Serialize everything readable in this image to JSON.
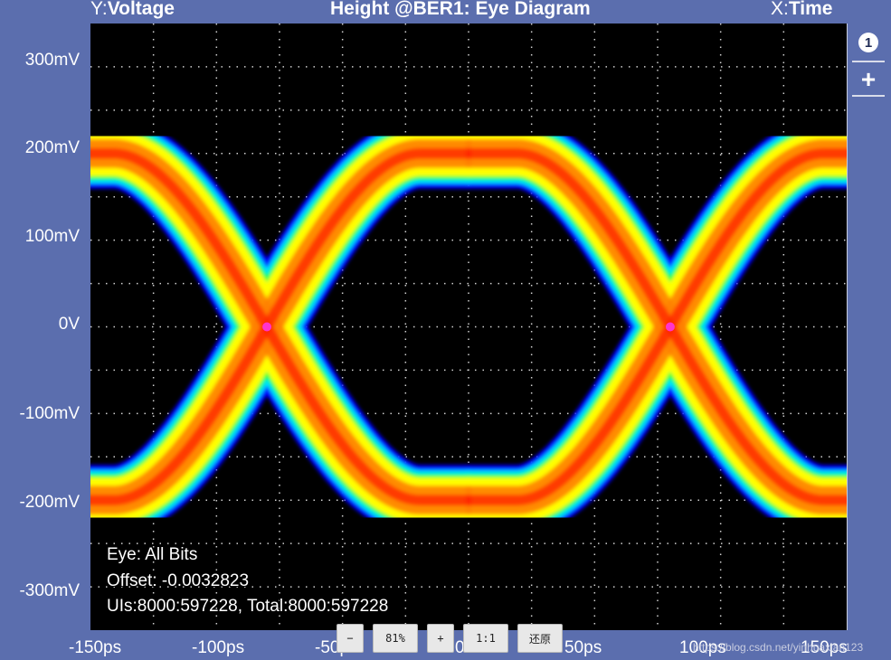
{
  "header": {
    "y_prefix": "Y:",
    "y_label": "Voltage",
    "title": "Height @BER1: Eye Diagram",
    "x_prefix": "X:",
    "x_label": "Time"
  },
  "chart_data": {
    "type": "heatmap",
    "title": "Height @BER1: Eye Diagram",
    "xlabel": "Time",
    "ylabel": "Voltage",
    "xlim": [
      -150,
      150
    ],
    "ylim": [
      -350,
      350
    ],
    "x_units": "ps",
    "y_units": "mV",
    "x_ticks": [
      "-150ps",
      "-100ps",
      "-50ps",
      "0s",
      "50ps",
      "100ps",
      "150ps"
    ],
    "y_ticks": [
      "300mV",
      "200mV",
      "100mV",
      "0V",
      "-100mV",
      "-200mV",
      "-300mV"
    ],
    "grid": true,
    "high_level_mV": 200,
    "low_level_mV": -200,
    "crossings_ps": [
      -80,
      80
    ],
    "crossing_level_mV": 0,
    "eye_opening_mV": [
      -170,
      175
    ],
    "colormap": [
      "#0000ff",
      "#00e5ff",
      "#00ff40",
      "#ffff00",
      "#ff8000",
      "#ff2000"
    ],
    "annotations": [
      "Eye: All Bits",
      "Offset: -0.0032823",
      "UIs:8000:597228, Total:8000:597228"
    ]
  },
  "toolbar": {
    "badge": "1",
    "plus": "+"
  },
  "zoom": {
    "minus": "−",
    "percent": "81%",
    "plus": "+",
    "one_to_one": "1:1",
    "restore": "还原"
  },
  "watermark": "https://blog.csdn.net/yinhuaxian123"
}
